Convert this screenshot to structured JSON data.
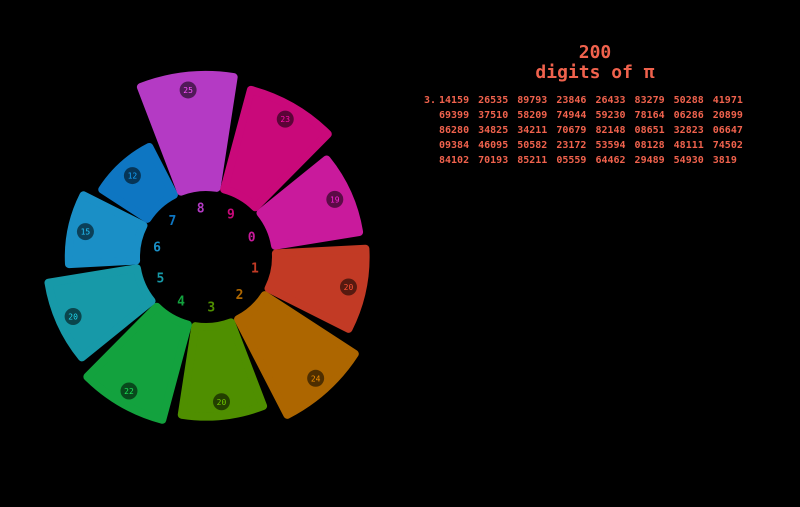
{
  "title": {
    "count": "200",
    "text": "digits of π"
  },
  "digits": {
    "lead": "3.",
    "rows": [
      [
        "14159",
        "26535",
        "89793",
        "23846",
        "26433",
        "83279",
        "50288",
        "41971"
      ],
      [
        "69399",
        "37510",
        "58209",
        "74944",
        "59230",
        "78164",
        "06286",
        "20899"
      ],
      [
        "86280",
        "34825",
        "34211",
        "70679",
        "82148",
        "08651",
        "32823",
        "06647"
      ],
      [
        "09384",
        "46095",
        "50582",
        "23172",
        "53594",
        "08128",
        "48111",
        "74502"
      ],
      [
        "84102",
        "70193",
        "85211",
        "05559",
        "64462",
        "29489",
        "54930",
        "3819"
      ]
    ]
  },
  "chart_data": {
    "type": "radial-bar",
    "title": "200 digits of π",
    "categories": [
      "0",
      "1",
      "2",
      "3",
      "4",
      "5",
      "6",
      "7",
      "8",
      "9"
    ],
    "values": [
      19,
      20,
      24,
      20,
      22,
      20,
      15,
      12,
      25,
      23
    ],
    "colors": [
      "#c91a9c",
      "#c23a25",
      "#ad6600",
      "#4f8f00",
      "#13a23e",
      "#1799a8",
      "#1a8fc6",
      "#0e76c2",
      "#b43ac4",
      "#c9097a"
    ],
    "max": 25
  }
}
